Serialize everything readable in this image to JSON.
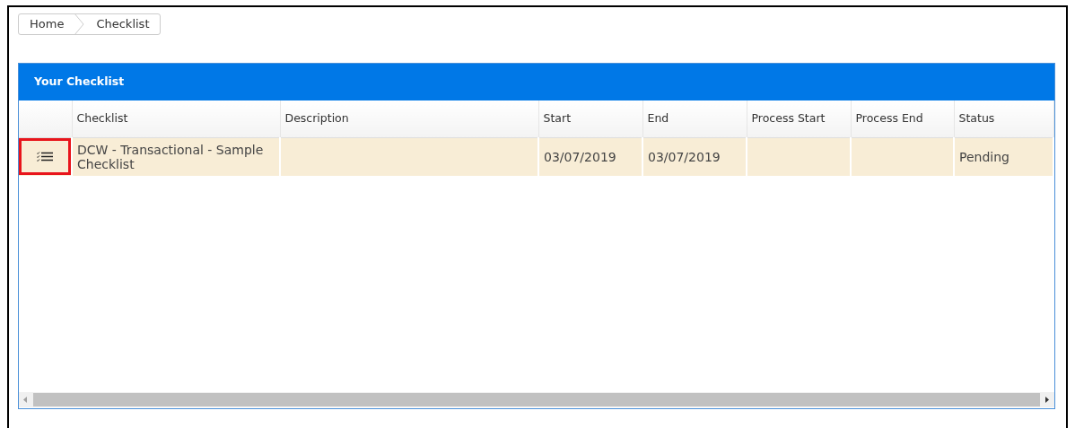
{
  "breadcrumb": [
    {
      "label": "Home"
    },
    {
      "label": "Checklist"
    }
  ],
  "panel": {
    "title": "Your Checklist"
  },
  "table": {
    "columns": [
      "Checklist",
      "Description",
      "Start",
      "End",
      "Process Start",
      "Process End",
      "Status"
    ],
    "rows": [
      {
        "selected": true,
        "action_highlighted": true,
        "cells": [
          "DCW - Transactional - Sample Checklist",
          "",
          "03/07/2019",
          "03/07/2019",
          "",
          "",
          "Pending"
        ]
      }
    ]
  }
}
